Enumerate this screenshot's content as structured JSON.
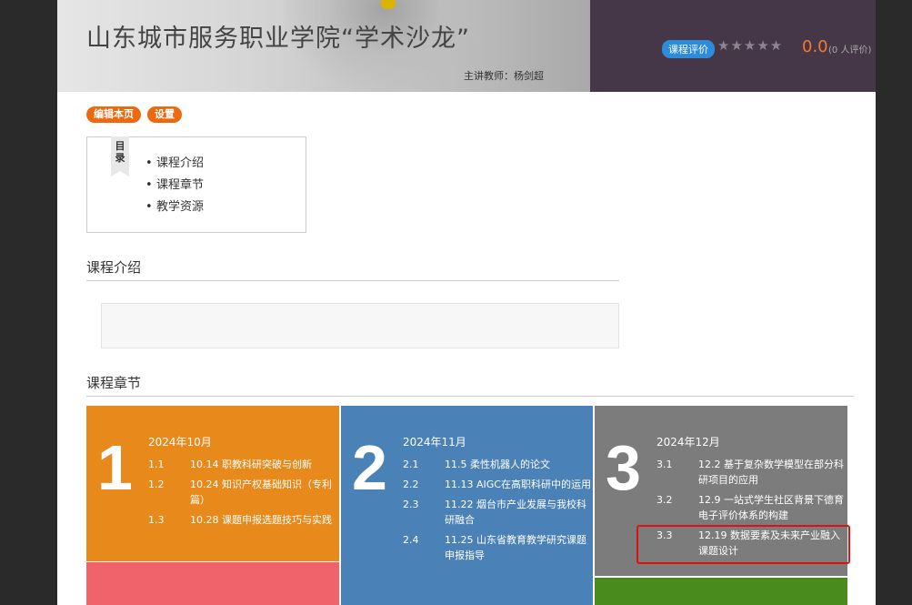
{
  "banner": {
    "title": "山东城市服务职业学院“学术沙龙”",
    "teacher": "主讲教师：杨剑超",
    "rate_label": "课程评价",
    "stars": "★★★★★",
    "score": "0.0",
    "rating_count": "(0 人评价)"
  },
  "actions": {
    "edit": "编辑本页",
    "settings": "设置"
  },
  "toc": {
    "tag": "目录",
    "items": [
      "课程介绍",
      "课程章节",
      "教学资源"
    ]
  },
  "sections": {
    "intro": "课程介绍",
    "chapters": "课程章节"
  },
  "colors": {
    "orange": "#e8891b",
    "blue": "#4a81b6",
    "gray": "#7c7c7c",
    "pink": "#f0636a",
    "green": "#4a8b1d",
    "highlight": "#e01010"
  },
  "chapters": [
    {
      "number": "1",
      "month": "2024年10月",
      "items": [
        {
          "idx": "1.1",
          "title": "10.14 职教科研突破与创新"
        },
        {
          "idx": "1.2",
          "title": "10.24 知识产权基础知识（专利篇）"
        },
        {
          "idx": "1.3",
          "title": "10.28 课题申报选题技巧与实践"
        }
      ]
    },
    {
      "number": "2",
      "month": "2024年11月",
      "items": [
        {
          "idx": "2.1",
          "title": "11.5 柔性机器人的论文"
        },
        {
          "idx": "2.2",
          "title": "11.13 AIGC在高职科研中的运用"
        },
        {
          "idx": "2.3",
          "title": "11.22 烟台市产业发展与我校科研融合"
        },
        {
          "idx": "2.4",
          "title": "11.25 山东省教育教学研究课题申报指导"
        }
      ]
    },
    {
      "number": "3",
      "month": "2024年12月",
      "items": [
        {
          "idx": "3.1",
          "title": "12.2 基于复杂数学模型在部分科研项目的应用"
        },
        {
          "idx": "3.2",
          "title": "12.9 一站式学生社区背景下德育电子评价体系的构建"
        },
        {
          "idx": "3.3",
          "title": "12.19 数据要素及未来产业融入课题设计"
        }
      ]
    }
  ]
}
